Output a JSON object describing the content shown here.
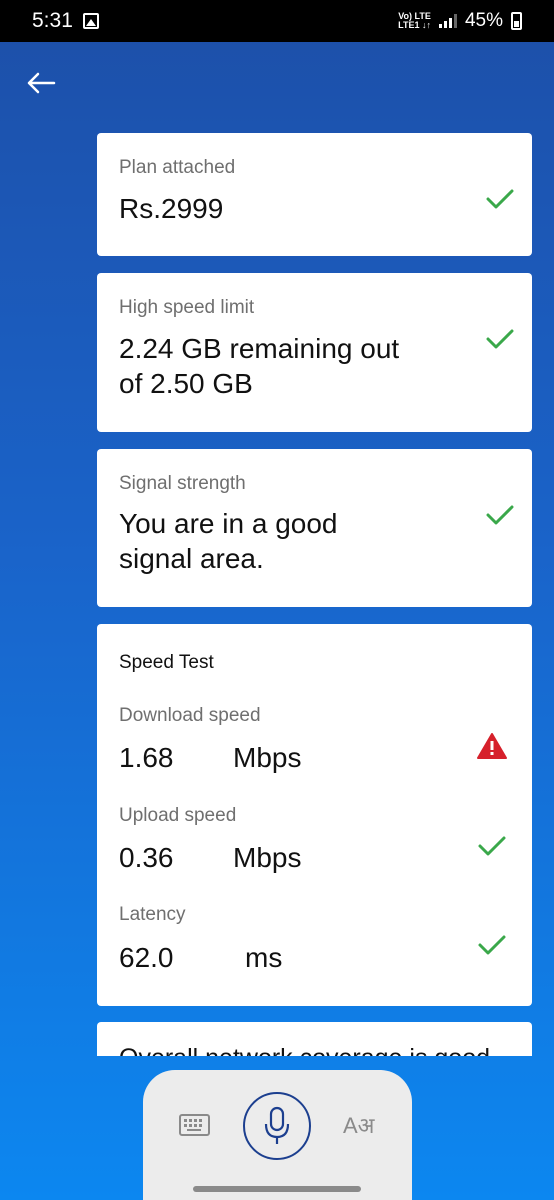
{
  "status_bar": {
    "time": "5:31",
    "network_top": "Vo) LTE",
    "network_bottom": "LTE1 ↓↑",
    "battery": "45%"
  },
  "cards": {
    "plan": {
      "label": "Plan attached",
      "value": "Rs.2999",
      "status": "ok"
    },
    "high_speed": {
      "label": "High speed limit",
      "value_line1": "2.24 GB remaining out",
      "value_line2": "of 2.50 GB",
      "status": "ok"
    },
    "signal": {
      "label": "Signal strength",
      "value_line1": "You are in a good",
      "value_line2": "signal area.",
      "status": "ok"
    }
  },
  "speed_test": {
    "title": "Speed Test",
    "download": {
      "label": "Download speed",
      "value": "1.68",
      "unit": "Mbps",
      "status": "warning"
    },
    "upload": {
      "label": "Upload speed",
      "value": "0.36",
      "unit": "Mbps",
      "status": "ok"
    },
    "latency": {
      "label": "Latency",
      "value": "62.0",
      "unit": "ms",
      "status": "ok"
    }
  },
  "coverage_text": "Overall network coverage is good",
  "input_bar": {
    "icons": [
      "keyboard-icon",
      "microphone-icon",
      "language-icon"
    ],
    "lang_glyph": "Aअ"
  },
  "colors": {
    "check_green": "#3aa84a",
    "warning_red": "#d6202b",
    "mic_blue": "#1c3f8f"
  }
}
